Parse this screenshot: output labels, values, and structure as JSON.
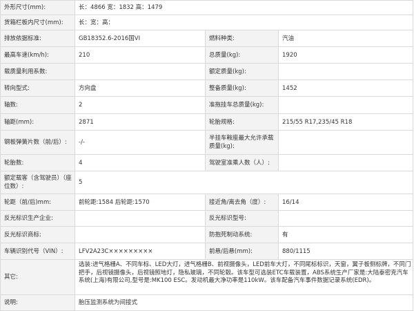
{
  "rows": [
    {
      "type": "full",
      "label": "外形尺寸(mm):",
      "value": "长：4866 宽：1832 高：1479"
    },
    {
      "type": "full",
      "label": "货箱栏板内尺寸(mm):",
      "value": "长：宽：高："
    },
    {
      "type": "pair",
      "l1": "排放依据标准:",
      "v1": "GB18352.6-2016国VI",
      "l2": "燃料种类:",
      "v2": "汽油"
    },
    {
      "type": "pair",
      "l1": "最高车速(km/h):",
      "v1": "210",
      "l2": "总质量(kg):",
      "v2": "1920"
    },
    {
      "type": "pair",
      "l1": "载质量利用系数:",
      "v1": "",
      "l2": "额定质量(kg):",
      "v2": ""
    },
    {
      "type": "pair",
      "l1": "转向型式:",
      "v1": "方向盘",
      "l2": "整备质量(kg):",
      "v2": "1452"
    },
    {
      "type": "pair",
      "l1": "轴数:",
      "v1": "2",
      "l2": "准拖挂车总质量(kg):",
      "v2": ""
    },
    {
      "type": "pair",
      "l1": "轴距(mm):",
      "v1": "2871",
      "l2": "轮胎规格:",
      "v2": "215/55 R17,235/45 R18"
    },
    {
      "type": "pair",
      "l1": "钢板弹簧片数（前/后）:",
      "v1": "-/-",
      "l2": "半挂车鞍座最大允许承载质量(kg):",
      "v2": ""
    },
    {
      "type": "pair",
      "l1": "轮胎数:",
      "v1": "4",
      "l2": "驾驶室准乘人数（人）:",
      "v2": ""
    },
    {
      "type": "full",
      "label": "额定载客（含驾驶员）（座位数）:",
      "value": "5"
    },
    {
      "type": "pair",
      "l1": "轮距（前/后)mm:",
      "v1": "前轮距:1584 后轮距:1570",
      "l2": "接近角/离去角（度）:",
      "v2": "16/14"
    },
    {
      "type": "pair",
      "l1": "反光标识生产企业:",
      "v1": "",
      "l2": "反光标识型号:",
      "v2": ""
    },
    {
      "type": "pair",
      "l1": "反光标识商标:",
      "v1": "",
      "l2": "防抱死制动系统:",
      "v2": "有"
    },
    {
      "type": "pair",
      "l1": "车辆识别代号（VIN）:",
      "v1": "LFV2A23C×××××××××",
      "l2": "前悬/后悬(mm):",
      "v2": "880/1115"
    },
    {
      "type": "full",
      "label": "其它:",
      "value": "选装:进气格栅A、不同车标、LED大灯，进气格栅B、前视摄像头，LED前车大灯，不同尾标标识，天窗，翼子板侧标牌，不同门把手，后视镜摄像头，后视镜照地灯，隐私玻璃，不同轮毂。该车型可选装ETC车载装置，ABS系统生产厂家是:大陆泰密克汽车系统(上海)有限公司,型号是:MK100 ESC。发动机最大净功率是110kW。该车配备汽车事件数据记录系统(EDR)。"
    },
    {
      "type": "full",
      "label": "说明:",
      "value": "胎压监测系统为间接式"
    }
  ]
}
